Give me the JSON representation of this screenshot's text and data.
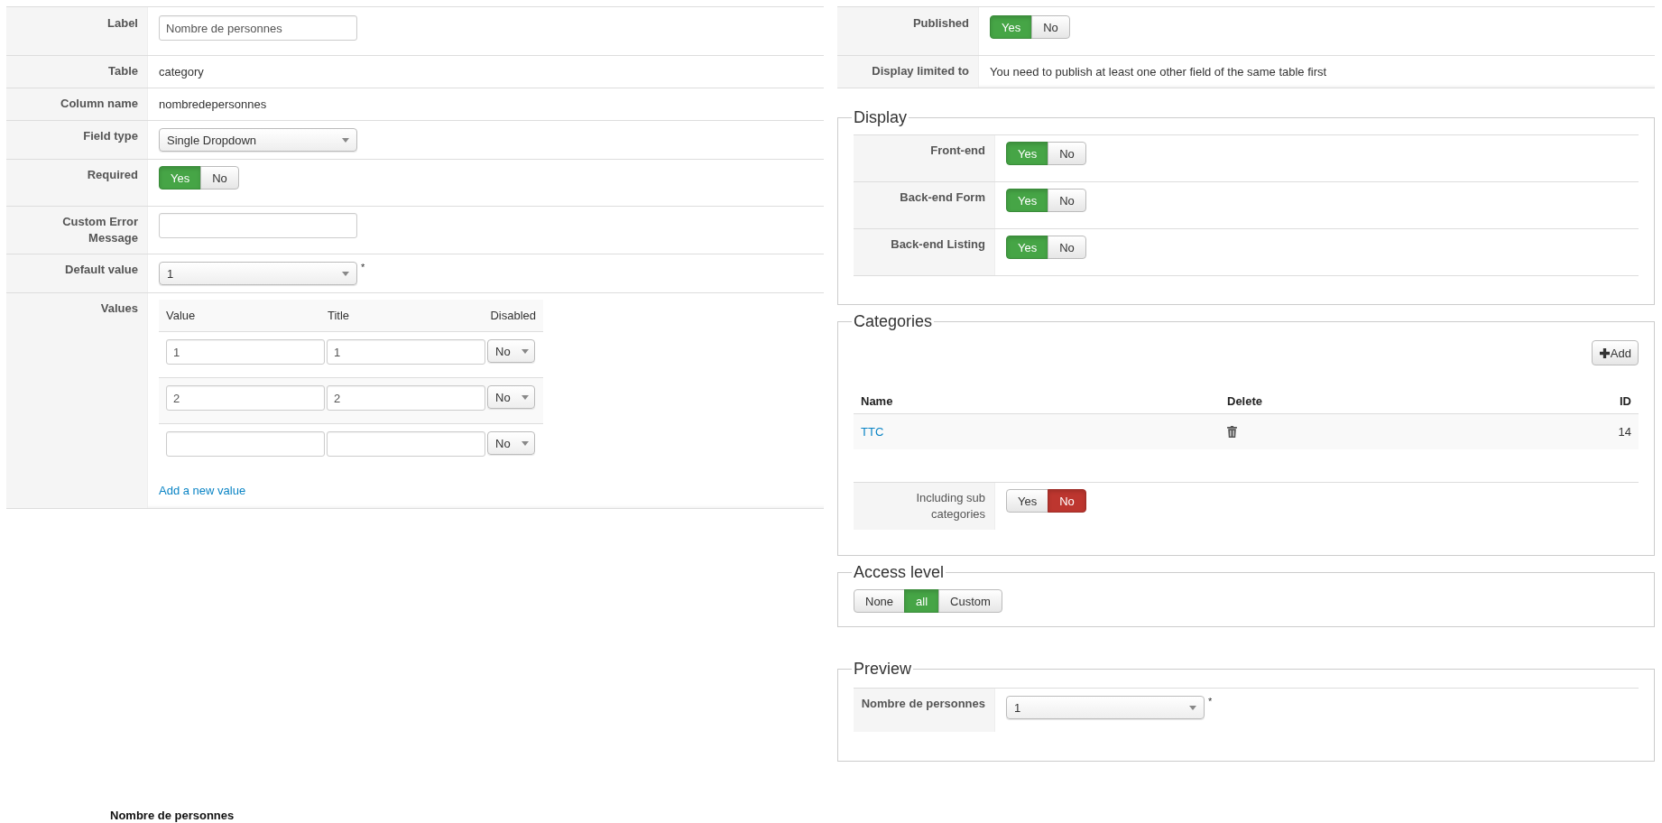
{
  "field_form": {
    "rows": [
      {
        "kind": "input",
        "label": "Label",
        "value": "Nombre de personnes"
      },
      {
        "kind": "text",
        "label": "Table",
        "value": "category"
      },
      {
        "kind": "text",
        "label": "Column name",
        "value": "nombredepersonnes"
      },
      {
        "kind": "select",
        "label": "Field type",
        "value": "Single Dropdown"
      },
      {
        "kind": "toggle",
        "label": "Required",
        "options": [
          {
            "label": "Yes",
            "kind": "positive",
            "selected": true
          },
          {
            "label": "No",
            "selected": false
          }
        ]
      },
      {
        "kind": "input",
        "label": "Custom Error Message"
      },
      {
        "kind": "select",
        "label": "Default value",
        "value": "1",
        "required_mark": "*"
      },
      {
        "kind": "values",
        "label": "Values",
        "columns": [
          "Value",
          "Title",
          "Disabled"
        ],
        "rows": [
          {
            "value": "1",
            "title": "1",
            "disabled": "No"
          },
          {
            "value": "2",
            "title": "2",
            "disabled": "No"
          },
          {
            "disabled": "No"
          }
        ],
        "add_link": "Add a new value"
      }
    ]
  },
  "footer_text": "Nombre de personnes",
  "status_form": {
    "rows": [
      {
        "kind": "toggle",
        "label": "Published",
        "options": [
          {
            "label": "Yes",
            "kind": "positive",
            "selected": true
          },
          {
            "label": "No",
            "selected": false
          }
        ]
      },
      {
        "kind": "text",
        "label": "Display limited to",
        "value": "You need to publish at least one other field of the same table first"
      }
    ]
  },
  "display": {
    "legend": "Display",
    "rows": [
      {
        "kind": "toggle",
        "label": "Front-end",
        "options": [
          {
            "label": "Yes",
            "kind": "positive",
            "selected": true
          },
          {
            "label": "No",
            "selected": false
          }
        ]
      },
      {
        "kind": "toggle",
        "label": "Back-end Form",
        "options": [
          {
            "label": "Yes",
            "kind": "positive",
            "selected": true
          },
          {
            "label": "No",
            "selected": false
          }
        ]
      },
      {
        "kind": "toggle",
        "label": "Back-end Listing",
        "options": [
          {
            "label": "Yes",
            "kind": "positive",
            "selected": true
          },
          {
            "label": "No",
            "selected": false
          }
        ]
      }
    ]
  },
  "categories": {
    "legend": "Categories",
    "add_button": "Add",
    "columns": [
      "Name",
      "Delete",
      "ID"
    ],
    "rows": [
      {
        "name": "TTC",
        "id": "14"
      }
    ],
    "rows_after": [
      {
        "kind": "toggle",
        "label": "Including sub categories",
        "options": [
          {
            "label": "Yes",
            "selected": false
          },
          {
            "label": "No",
            "kind": "negative",
            "selected": true
          }
        ]
      }
    ]
  },
  "access_level": {
    "legend": "Access level",
    "options": [
      {
        "label": "None",
        "selected": false
      },
      {
        "label": "all",
        "kind": "positive",
        "selected": true
      },
      {
        "label": "Custom",
        "selected": false
      }
    ]
  },
  "preview": {
    "legend": "Preview",
    "rows": [
      {
        "kind": "select",
        "label": "Nombre de personnes",
        "value": "1",
        "required_mark": "*"
      }
    ]
  }
}
